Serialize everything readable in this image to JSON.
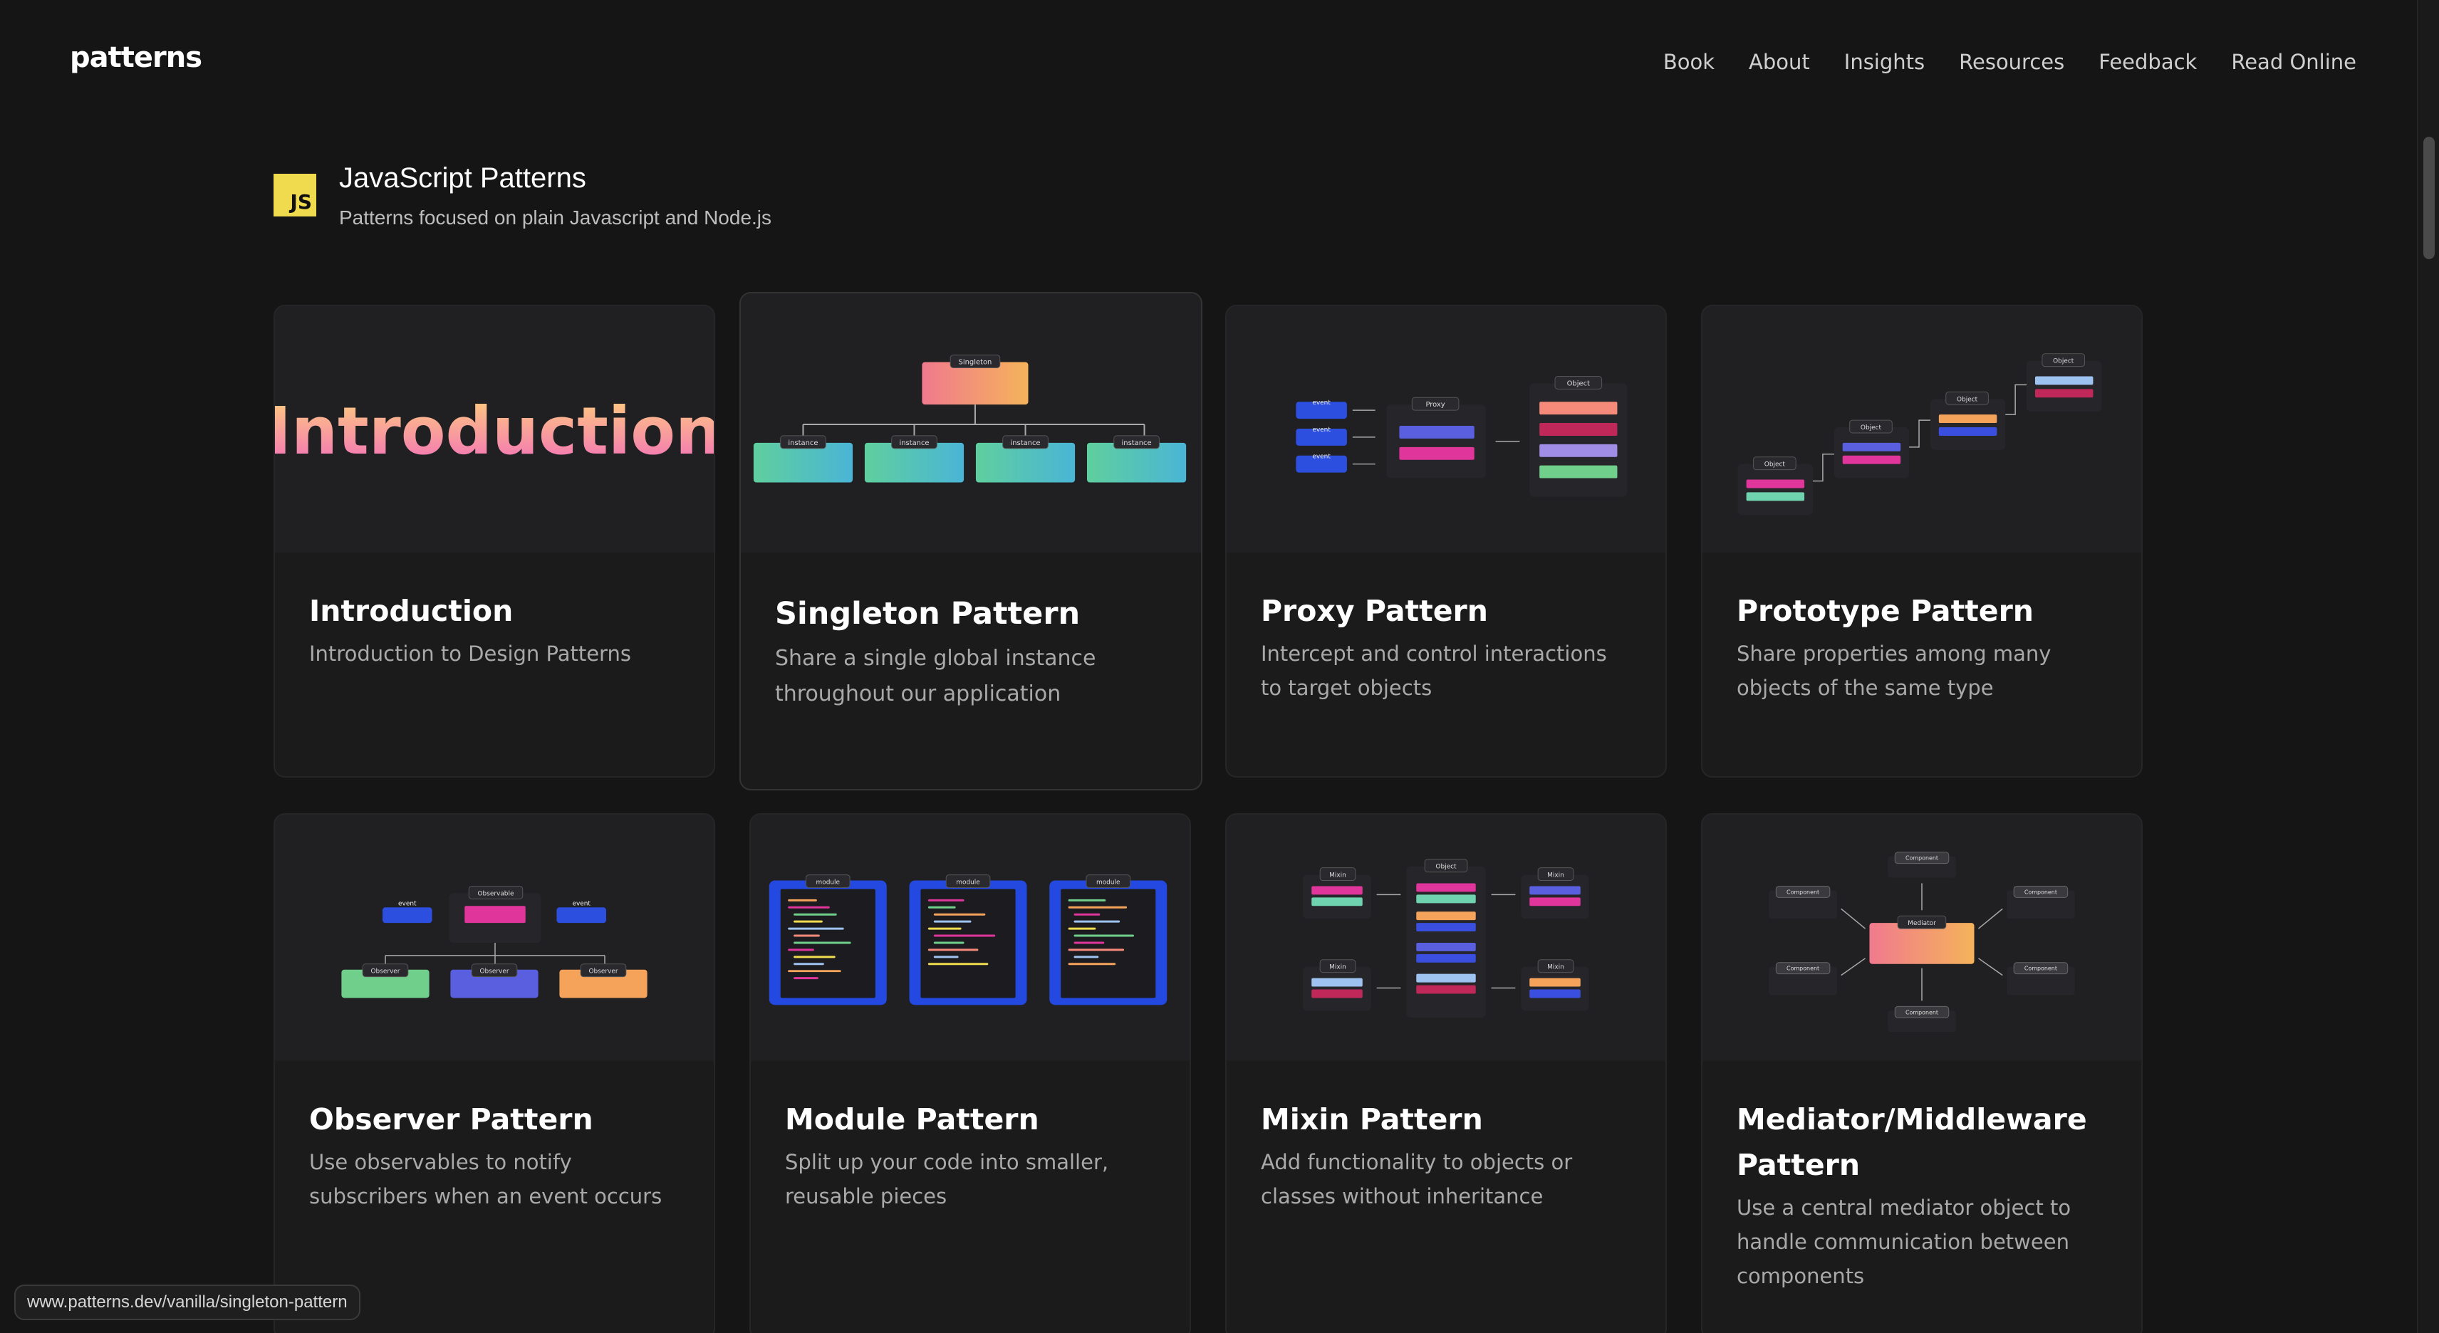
{
  "header": {
    "logo": "patterns",
    "nav": [
      "Book",
      "About",
      "Insights",
      "Resources",
      "Feedback",
      "Read Online"
    ]
  },
  "section": {
    "badge": "JS",
    "title": "JavaScript Patterns",
    "subtitle": "Patterns focused on plain Javascript and Node.js"
  },
  "cards": [
    {
      "title": "Introduction",
      "description": "Introduction to Design Patterns",
      "thumb_text": "Introduction"
    },
    {
      "title": "Singleton Pattern",
      "description": "Share a single global instance throughout our application",
      "thumb_labels": {
        "root": "Singleton",
        "child": "instance"
      }
    },
    {
      "title": "Proxy Pattern",
      "description": "Intercept and control interactions to target objects",
      "thumb_labels": {
        "event": "event",
        "proxy": "Proxy",
        "object": "Object"
      }
    },
    {
      "title": "Prototype Pattern",
      "description": "Share properties among many objects of the same type",
      "thumb_labels": {
        "object": "Object"
      }
    },
    {
      "title": "Observer Pattern",
      "description": "Use observables to notify subscribers when an event occurs",
      "thumb_labels": {
        "observable": "Observable",
        "event": "event",
        "observer": "Observer"
      }
    },
    {
      "title": "Module Pattern",
      "description": "Split up your code into smaller, reusable pieces",
      "thumb_labels": {
        "module": "module"
      }
    },
    {
      "title": "Mixin Pattern",
      "description": "Add functionality to objects or classes without inheritance",
      "thumb_labels": {
        "mixin": "Mixin",
        "object": "Object"
      }
    },
    {
      "title": "Mediator/Middleware Pattern",
      "description": "Use a central mediator object to handle communication between components",
      "thumb_labels": {
        "mediator": "Mediator",
        "component": "Component"
      }
    }
  ],
  "status_url": "www.patterns.dev/vanilla/singleton-pattern",
  "colors": {
    "background": "#151515",
    "card": "#1b1b1c",
    "js_yellow": "#f0db4f"
  }
}
